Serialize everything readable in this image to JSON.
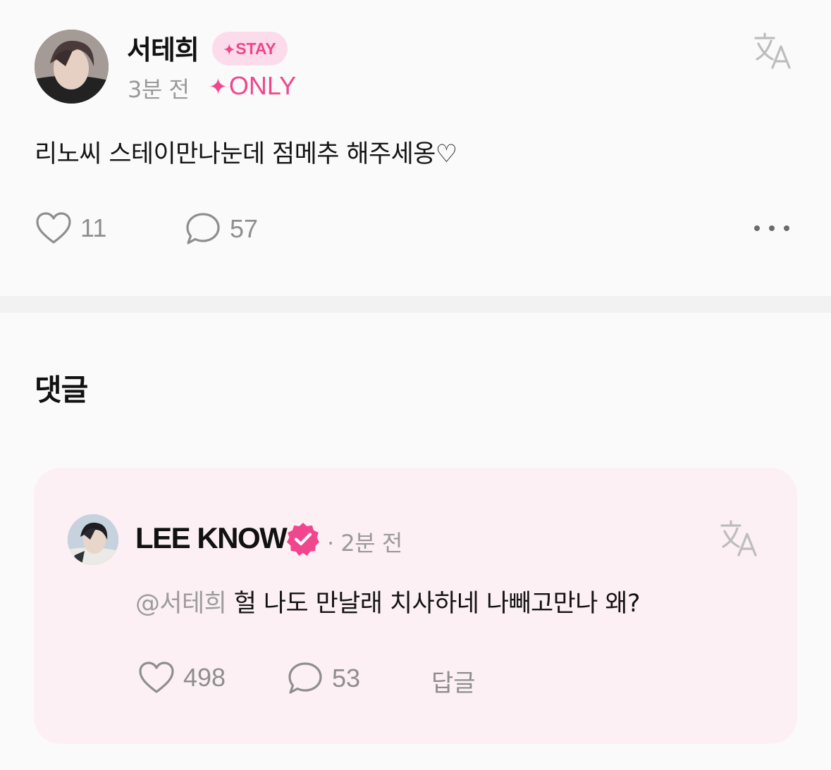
{
  "post": {
    "author_name": "서테희",
    "badge_label": "STAY",
    "time": "3분 전",
    "visibility_label": "ONLY",
    "body": "리노씨 스테이만나눈데 점메추 해주세옹♡",
    "likes": "11",
    "comments": "57",
    "translate_icon": "translate-icon",
    "more_icon": "more-horizontal-icon"
  },
  "comments_section": {
    "heading": "댓글"
  },
  "comment": {
    "author_name": "LEE KNOW",
    "verified_icon": "verified-badge-icon",
    "time": "· 2분 전",
    "mention": "@서테희",
    "body": " 헐 나도 만날래 치사하네 나빼고만나 왜?",
    "likes": "498",
    "comments": "53",
    "reply_label": "답글"
  },
  "colors": {
    "accent_pink": "#f0468e",
    "badge_background": "#fcdcea",
    "comment_card_background": "#fcf0f4",
    "secondary_text": "#9a9a9a",
    "icon_gray": "#8e8e8e"
  }
}
